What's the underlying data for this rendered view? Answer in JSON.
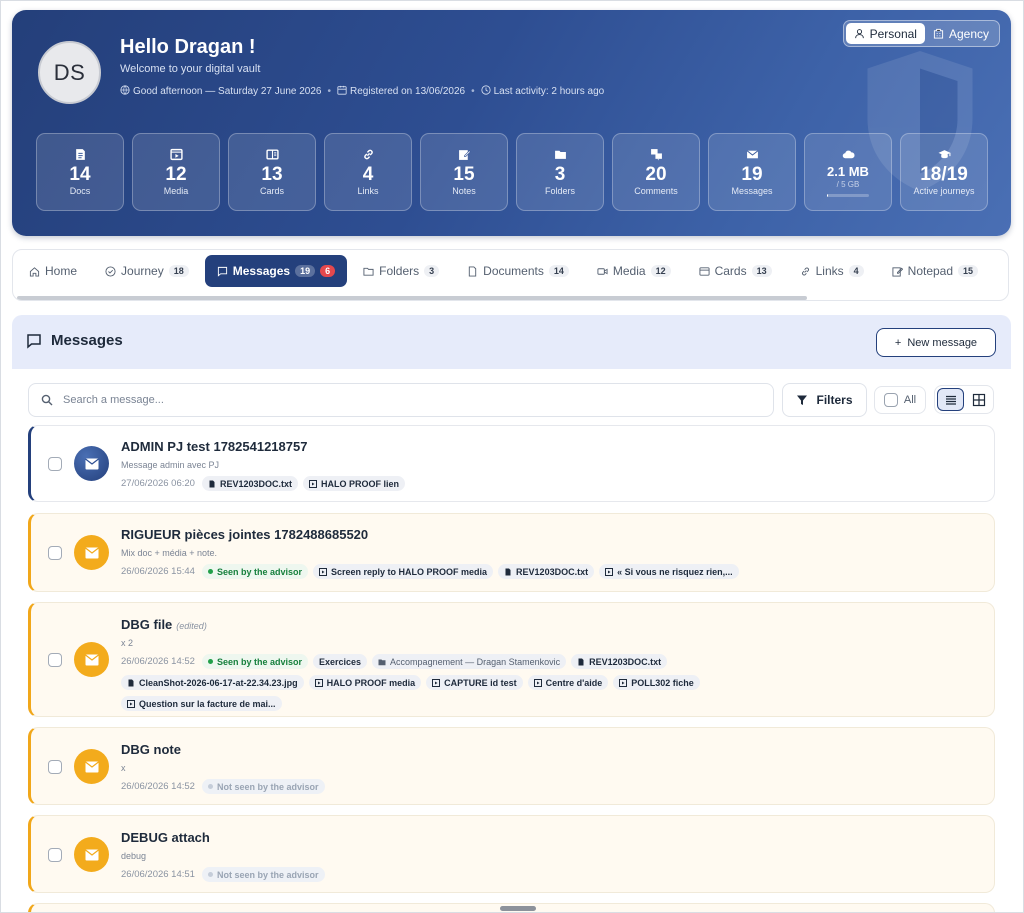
{
  "hero": {
    "initials": "DS",
    "greeting": "Hello Dragan !",
    "welcome": "Welcome to your digital vault",
    "meta": {
      "time_greeting": "Good afternoon — Saturday 27 June 2026",
      "registered": "Registered on 13/06/2026",
      "last_activity": "Last activity: 2 hours ago"
    },
    "switch": {
      "personal": "Personal",
      "agency": "Agency",
      "active": "Personal"
    },
    "stats": [
      {
        "icon": "document-icon",
        "value": "14",
        "label": "Docs"
      },
      {
        "icon": "media-play-icon",
        "value": "12",
        "label": "Media"
      },
      {
        "icon": "card-icon",
        "value": "13",
        "label": "Cards"
      },
      {
        "icon": "link-icon",
        "value": "4",
        "label": "Links"
      },
      {
        "icon": "note-edit-icon",
        "value": "15",
        "label": "Notes"
      },
      {
        "icon": "folder-icon",
        "value": "3",
        "label": "Folders"
      },
      {
        "icon": "comments-icon",
        "value": "20",
        "label": "Comments"
      },
      {
        "icon": "envelope-icon",
        "value": "19",
        "label": "Messages"
      },
      {
        "icon": "cloud-icon",
        "value": "2.1 MB",
        "sub": "/ 5 GB",
        "storage_fraction": 0.0004
      },
      {
        "icon": "graduation-cap-icon",
        "value": "18/19",
        "label": "Active journeys"
      }
    ]
  },
  "tabs": [
    {
      "icon": "home-icon",
      "label": "Home"
    },
    {
      "icon": "check-circle-icon",
      "label": "Journey",
      "count": "18"
    },
    {
      "icon": "message-icon",
      "label": "Messages",
      "count": "19",
      "unread": "6",
      "active": true
    },
    {
      "icon": "folder-icon",
      "label": "Folders",
      "count": "3"
    },
    {
      "icon": "document-icon",
      "label": "Documents",
      "count": "14"
    },
    {
      "icon": "video-icon",
      "label": "Media",
      "count": "12"
    },
    {
      "icon": "card-icon",
      "label": "Cards",
      "count": "13"
    },
    {
      "icon": "link-icon",
      "label": "Links",
      "count": "4"
    },
    {
      "icon": "note-edit-icon",
      "label": "Notepad",
      "count": "15"
    }
  ],
  "panel": {
    "title": "Messages",
    "new_button": "New message",
    "search_placeholder": "Search a message...",
    "filters_label": "Filters",
    "all_label": "All"
  },
  "messages": [
    {
      "title": "ADMIN PJ test 1782541218757",
      "desc": "Message admin avec PJ",
      "date": "27/06/2026 06:20",
      "status": "",
      "tags": [
        {
          "icon": "file-icon",
          "text": "REV1203DOC.txt"
        },
        {
          "icon": "media-icon",
          "text": "HALO PROOF lien"
        }
      ]
    },
    {
      "title": "RIGUEUR pièces jointes 1782488685520",
      "desc": "Mix doc + média + note.",
      "date": "26/06/2026 15:44",
      "status": "Seen by the advisor",
      "tags": [
        {
          "icon": "media-icon",
          "text": "Screen reply to HALO PROOF media"
        },
        {
          "icon": "file-icon",
          "text": "REV1203DOC.txt"
        },
        {
          "icon": "media-icon",
          "text": "« Si vous ne risquez rien,..."
        }
      ]
    },
    {
      "title": "DBG file",
      "edited": "(edited)",
      "desc": "x 2",
      "date": "26/06/2026 14:52",
      "status": "Seen by the advisor",
      "tags": [
        {
          "text": "Exercices"
        },
        {
          "icon": "folder-icon",
          "text": "Accompagnement — Dragan Stamenkovic"
        },
        {
          "icon": "file-icon",
          "text": "REV1203DOC.txt"
        },
        {
          "icon": "file-icon",
          "text": "CleanShot-2026-06-17-at-22.34.23.jpg"
        },
        {
          "icon": "media-icon",
          "text": "HALO PROOF media"
        },
        {
          "icon": "media-icon",
          "text": "CAPTURE id test"
        },
        {
          "icon": "media-icon",
          "text": "Centre d'aide"
        },
        {
          "icon": "media-icon",
          "text": "POLL302 fiche"
        },
        {
          "icon": "media-icon",
          "text": "Question sur la facture de mai..."
        }
      ]
    },
    {
      "title": "DBG note",
      "desc": "x",
      "date": "26/06/2026 14:52",
      "status": "Not seen by the advisor",
      "tags": []
    },
    {
      "title": "DEBUG attach",
      "desc": "debug",
      "date": "26/06/2026 14:51",
      "status": "Not seen by the advisor",
      "tags": []
    }
  ]
}
